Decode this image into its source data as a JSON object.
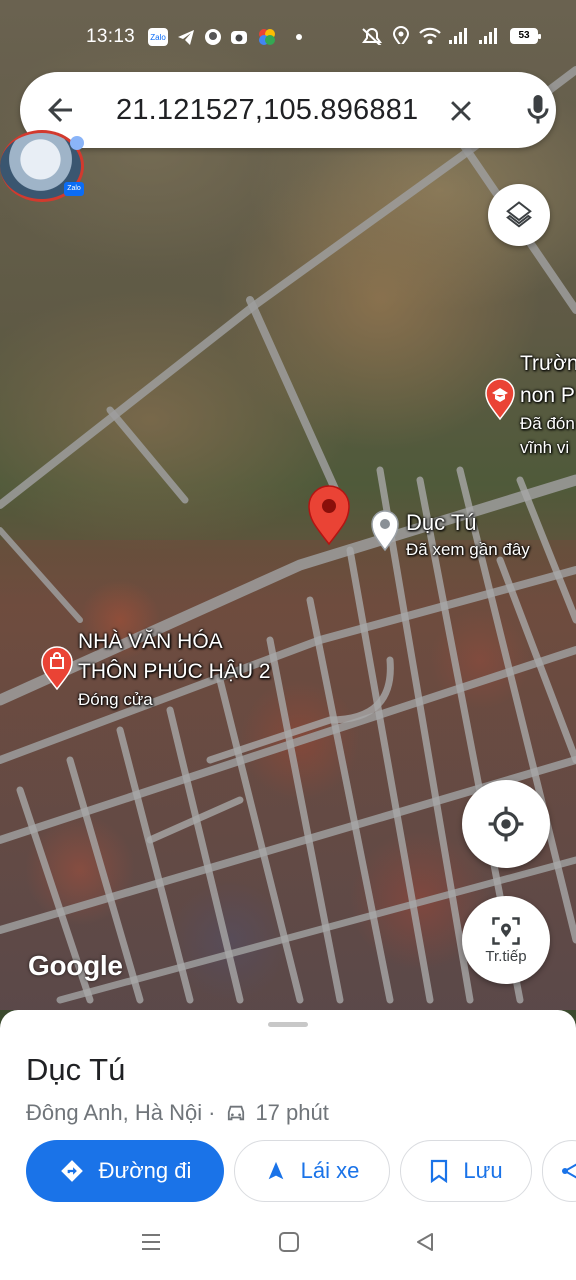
{
  "status_bar": {
    "time": "13:13",
    "battery": "53",
    "notification_icons": [
      "zalo-icon",
      "telegram-icon",
      "app-icon",
      "camera-icon",
      "photos-icon",
      "dot-icon"
    ],
    "system_icons": [
      "mute-icon",
      "location-icon",
      "wifi-icon",
      "signal-icon",
      "signal-icon"
    ]
  },
  "search": {
    "query": "21.121527,105.896881"
  },
  "chat_bubble": {
    "badge": "Zalo"
  },
  "map": {
    "labels": {
      "school_line1": "Trườn",
      "school_line2": "non P",
      "school_line3": "Đã đón",
      "school_line4": "vĩnh vi",
      "selected_place_name": "Dục Tú",
      "selected_place_note": "Đã xem gần đây",
      "culture_house_line1": "NHÀ VĂN HÓA",
      "culture_house_line2": "THÔN PHÚC HẬU 2",
      "culture_house_status": "Đóng cửa"
    },
    "attribution": "Google",
    "live_view_label": "Tr.tiếp"
  },
  "sheet": {
    "title": "Dục Tú",
    "location": "Đông Anh, Hà Nội",
    "separator": "·",
    "drive_time": "17 phút",
    "buttons": {
      "directions": "Đường đi",
      "start": "Lái xe",
      "save": "Lưu"
    }
  },
  "colors": {
    "accent": "#1a73e8",
    "pin_red": "#ea4335",
    "text_primary": "#202124",
    "text_secondary": "#70757a"
  }
}
